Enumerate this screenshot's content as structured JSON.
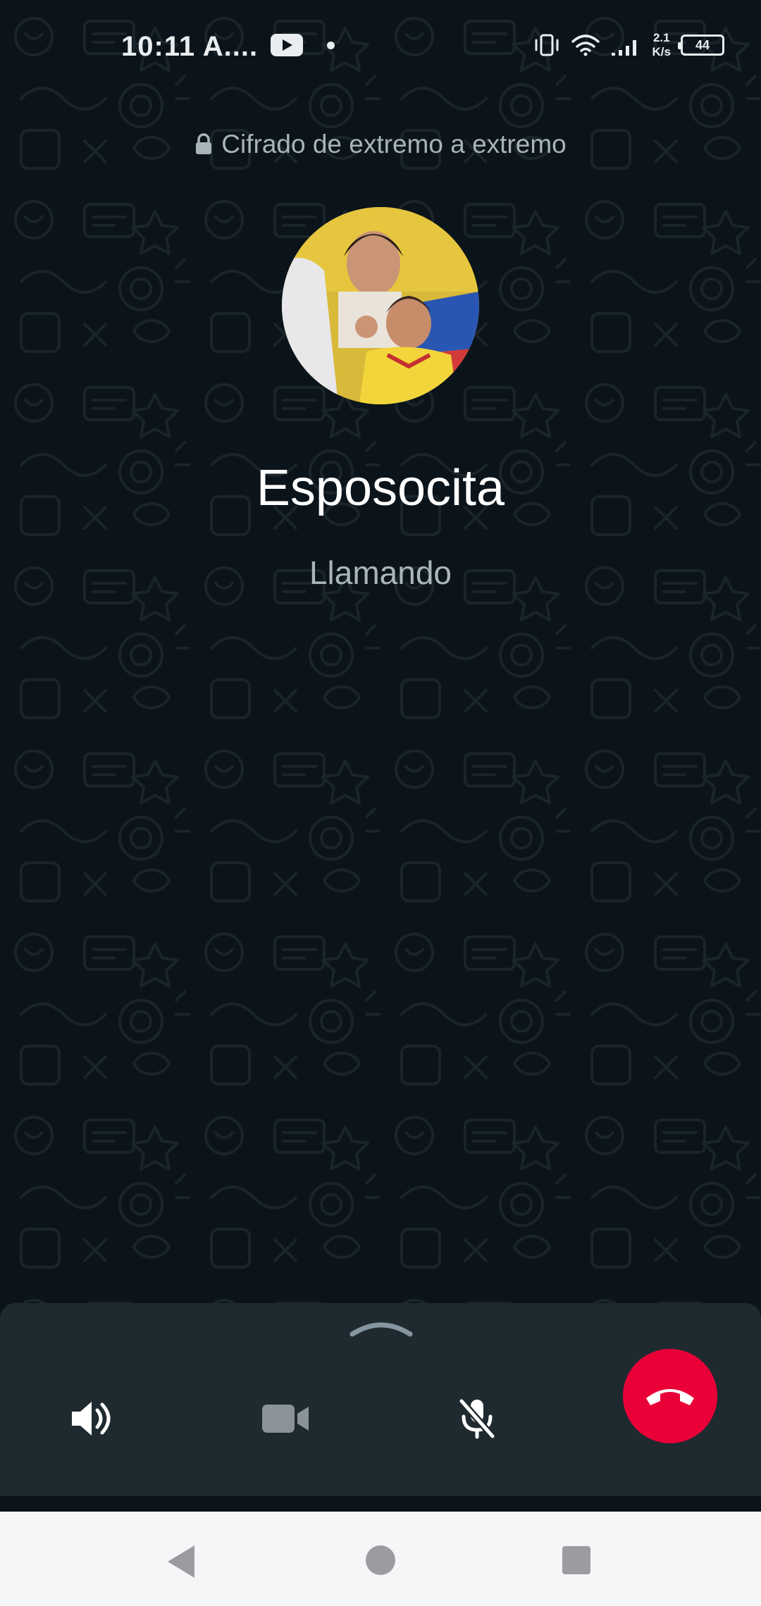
{
  "status_bar": {
    "time": "10:11 A....",
    "net_speed_value": "2.1",
    "net_speed_unit": "K/s",
    "battery": "44",
    "icons": [
      "youtube-icon",
      "notification-dot-icon",
      "vibrate-icon",
      "wifi-icon",
      "signal-icon",
      "battery-icon"
    ]
  },
  "call": {
    "encryption_text": "Cifrado de extremo a extremo",
    "contact_name": "Esposocita",
    "status": "Llamando"
  },
  "controls": {
    "buttons": [
      "speaker-icon",
      "video-icon",
      "mic-muted-icon",
      "end-call-icon"
    ],
    "colors": {
      "panel": "#1f2a30",
      "end_call": "#ea0038",
      "background": "#0b141a"
    }
  },
  "navbar": {
    "icons": [
      "back-icon",
      "home-icon",
      "recents-icon"
    ]
  }
}
